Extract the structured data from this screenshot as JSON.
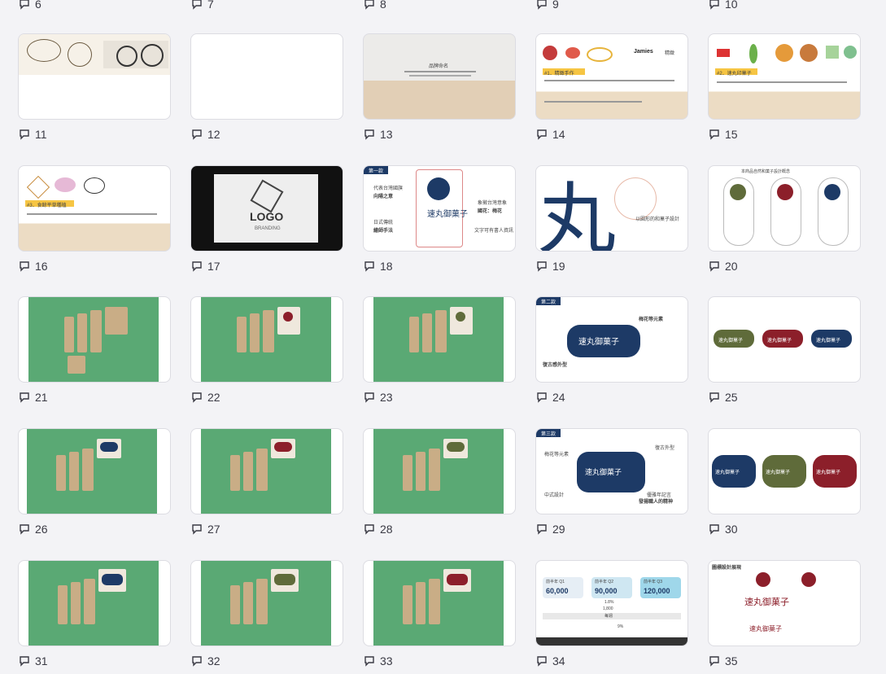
{
  "rows": [
    {
      "top_labels": [
        "6",
        "7",
        "8",
        "9",
        "10"
      ]
    },
    {
      "labels": [
        "11",
        "12",
        "13",
        "14",
        "15"
      ]
    },
    {
      "labels": [
        "16",
        "17",
        "18",
        "19",
        "20"
      ]
    },
    {
      "labels": [
        "21",
        "22",
        "23",
        "24",
        "25"
      ]
    },
    {
      "labels": [
        "26",
        "27",
        "28",
        "29",
        "30"
      ]
    },
    {
      "labels": [
        "31",
        "32",
        "33",
        "34",
        "35"
      ]
    }
  ],
  "slides": {
    "13": {
      "title": "品牌命名"
    },
    "14": {
      "name": "Jamies",
      "tag": "#1．精緻手作",
      "right": "精緻"
    },
    "15": {
      "tag": "#2．速丸印菓子"
    },
    "16": {
      "tag": "#3．食餘平草種植"
    },
    "17": {
      "logo": "LOGO",
      "sub": "BRANDING"
    },
    "18": {
      "badge": "第一款",
      "t1": "代表台灣國旗",
      "t2": "向陽之意",
      "t3": "日式傳統",
      "t4": "繪師手法",
      "t5": "象徵台灣意象",
      "t6": "國花：梅花",
      "t7": "文字可有書人資訊",
      "brand": "速丸御菓子"
    },
    "19": {
      "glyph": "丸",
      "note": "以圓形的和菓子設計"
    },
    "20": {
      "title": "本商品自然和菓子設計概念"
    },
    "24": {
      "badge": "第二款",
      "t1": "梅花等元素",
      "t2": "復古感外型",
      "brand": "速丸御菓子"
    },
    "25": {
      "brand": "速丸御菓子"
    },
    "29": {
      "badge": "第三款",
      "t1": "梅花等元素",
      "t2": "復古外型",
      "t3": "中式設計",
      "t4": "優雅年記言",
      "t5": "發揚職人的精神",
      "brand": "速丸御菓子"
    },
    "30": {
      "brand": "速丸御菓子"
    },
    "34": {
      "heads": [
        "前半年 Q1",
        "前半年 Q2",
        "前半年 Q3"
      ],
      "values": [
        "60,000",
        "90,000",
        "120,000"
      ],
      "sub": "1.8%",
      "total": "1,800",
      "mid": "每週",
      "foot": "9%"
    },
    "35": {
      "title": "圖標設計展現",
      "brand": "速丸御菓子"
    }
  },
  "colors": {
    "green": "#5aa974",
    "navy": "#1d3a66",
    "olive": "#5f6b3a",
    "wine": "#8c1f2a",
    "kraft": "#c9ad86"
  }
}
